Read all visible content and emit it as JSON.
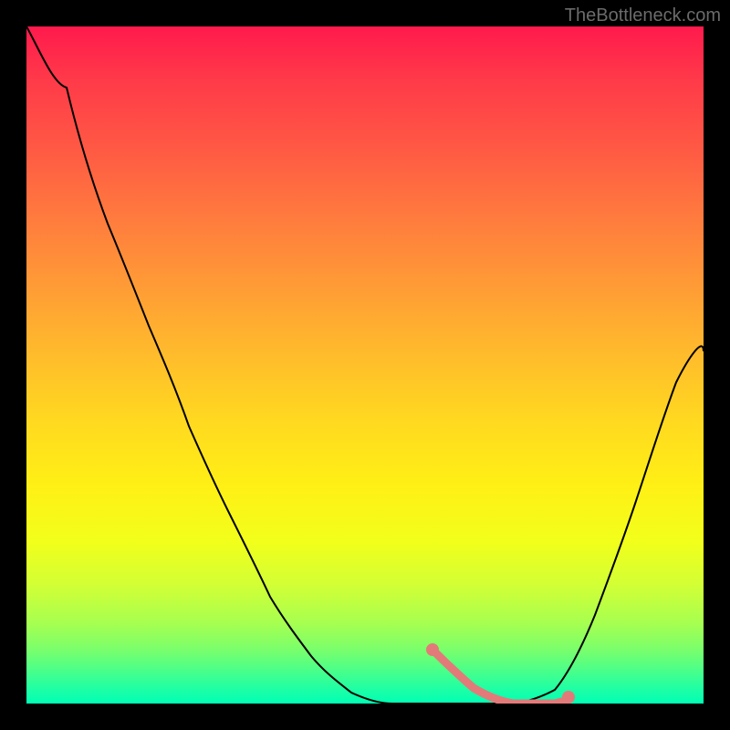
{
  "watermark": "TheBottleneck.com",
  "chart_data": {
    "type": "line",
    "title": "",
    "xlabel": "",
    "ylabel": "",
    "xlim": [
      0,
      100
    ],
    "ylim": [
      0,
      100
    ],
    "grid": false,
    "series": [
      {
        "name": "curve",
        "color": "#000000",
        "x": [
          0,
          6,
          12,
          18,
          24,
          30,
          36,
          42,
          48,
          54,
          60,
          63,
          66,
          69,
          72,
          75,
          78,
          80,
          84,
          88,
          92,
          96,
          100
        ],
        "values": [
          100,
          91,
          81,
          71,
          61,
          51,
          41,
          32,
          23,
          15,
          8,
          5,
          2,
          1,
          0,
          0,
          0,
          1,
          5,
          13,
          24,
          37,
          52
        ]
      },
      {
        "name": "highlight",
        "color": "#e37a7a",
        "x": [
          60,
          63,
          66,
          69,
          72,
          75,
          78,
          80
        ],
        "values": [
          8,
          5,
          2,
          1,
          0,
          0,
          0,
          1
        ]
      }
    ],
    "gradient_colors": [
      "#ff1a4d",
      "#ffd820",
      "#00ffb3"
    ]
  }
}
